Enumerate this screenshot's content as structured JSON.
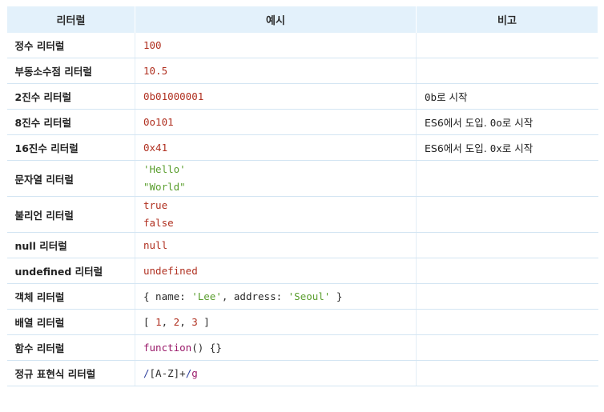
{
  "headers": {
    "literal": "리터럴",
    "example": "예시",
    "note": "비고"
  },
  "rows": [
    {
      "name": "정수 리터럴",
      "example": "100"
    },
    {
      "name": "부동소수점 리터럴",
      "example": "10.5"
    },
    {
      "name": "2진수 리터럴",
      "example": "0b01000001",
      "note_code": "0b",
      "note_text": "로 시작"
    },
    {
      "name": "8진수 리터럴",
      "example": "0o101",
      "note_prefix": "ES6에서 도입. ",
      "note_code": "0o",
      "note_text": "로 시작"
    },
    {
      "name": "16진수 리터럴",
      "example": "0x41",
      "note_prefix": "ES6에서 도입. ",
      "note_code": "0x",
      "note_text": "로 시작"
    },
    {
      "name": "문자열 리터럴",
      "lines": [
        "'Hello'",
        "\"World\""
      ]
    },
    {
      "name": "불리언 리터럴",
      "lines": [
        "true",
        "false"
      ]
    },
    {
      "name": "null 리터럴",
      "example": "null"
    },
    {
      "name": "undefined 리터럴",
      "example": "undefined"
    },
    {
      "name": "객체 리터럴",
      "parts": [
        "{ name: ",
        "'Lee'",
        ", address: ",
        "'Seoul'",
        " }"
      ]
    },
    {
      "name": "배열 리터럴",
      "parts": [
        "[ ",
        "1",
        ", ",
        "2",
        ", ",
        "3",
        " ]"
      ]
    },
    {
      "name": "함수 리터럴",
      "parts": [
        "function",
        "() {}"
      ]
    },
    {
      "name": "정규 표현식 리터럴",
      "parts": [
        "/",
        "[A-Z]+",
        "/",
        "g"
      ]
    }
  ]
}
